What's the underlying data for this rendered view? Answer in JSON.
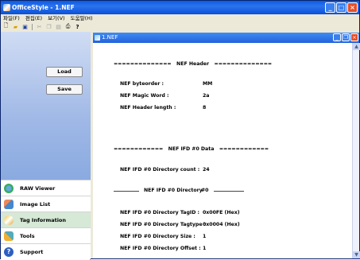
{
  "window": {
    "title": "OfficeStyle - 1.NEF"
  },
  "menu": [
    "파일(F)",
    "편집(E)",
    "보기(V)",
    "도움말(H)"
  ],
  "toolbar_icons": [
    "new-icon",
    "open-icon",
    "save-icon",
    "cut-icon",
    "copy-icon",
    "paste-icon",
    "print-icon",
    "help-icon"
  ],
  "left": {
    "load_label": "Load",
    "save_label": "Save",
    "nav": [
      {
        "label": "RAW Viewer",
        "icon": "raw-viewer-icon"
      },
      {
        "label": "Image List",
        "icon": "image-list-icon"
      },
      {
        "label": "Tag Information",
        "icon": "tag-info-icon"
      },
      {
        "label": "Tools",
        "icon": "tools-icon"
      },
      {
        "label": "Support",
        "icon": "support-icon"
      }
    ]
  },
  "child": {
    "title": "1.NEF"
  },
  "doc": {
    "header_line": "==============   NEF Header   ==============",
    "byteorder_label": "NEF byteorder :",
    "byteorder_value": "MM",
    "magic_label": "NEF Magic Word :",
    "magic_value": "2a",
    "hlen_label": "NEF Header length :",
    "hlen_value": "8",
    "ifd_data_line": "============   NEF IFD #0 Data   ============",
    "dircount_label": "NEF IFD #0 Directory count :",
    "dircount_value": "24",
    "dir_heading": "NEF IFD #0 Directory",
    "dir_heading_num": "#0",
    "tagid_label": "NEF IFD #0 Directory TagID :",
    "tagid_value": "0x00FE (Hex)",
    "tagtype_label": "NEF IFD #0 Directory Tagtype :",
    "tagtype_value": "0x0004 (Hex)",
    "size_label": "NEF IFD #0 Directory Size :",
    "size_value": "1",
    "offset_label": "NEF IFD #0 Directory Offset :",
    "offset_value": "1"
  }
}
